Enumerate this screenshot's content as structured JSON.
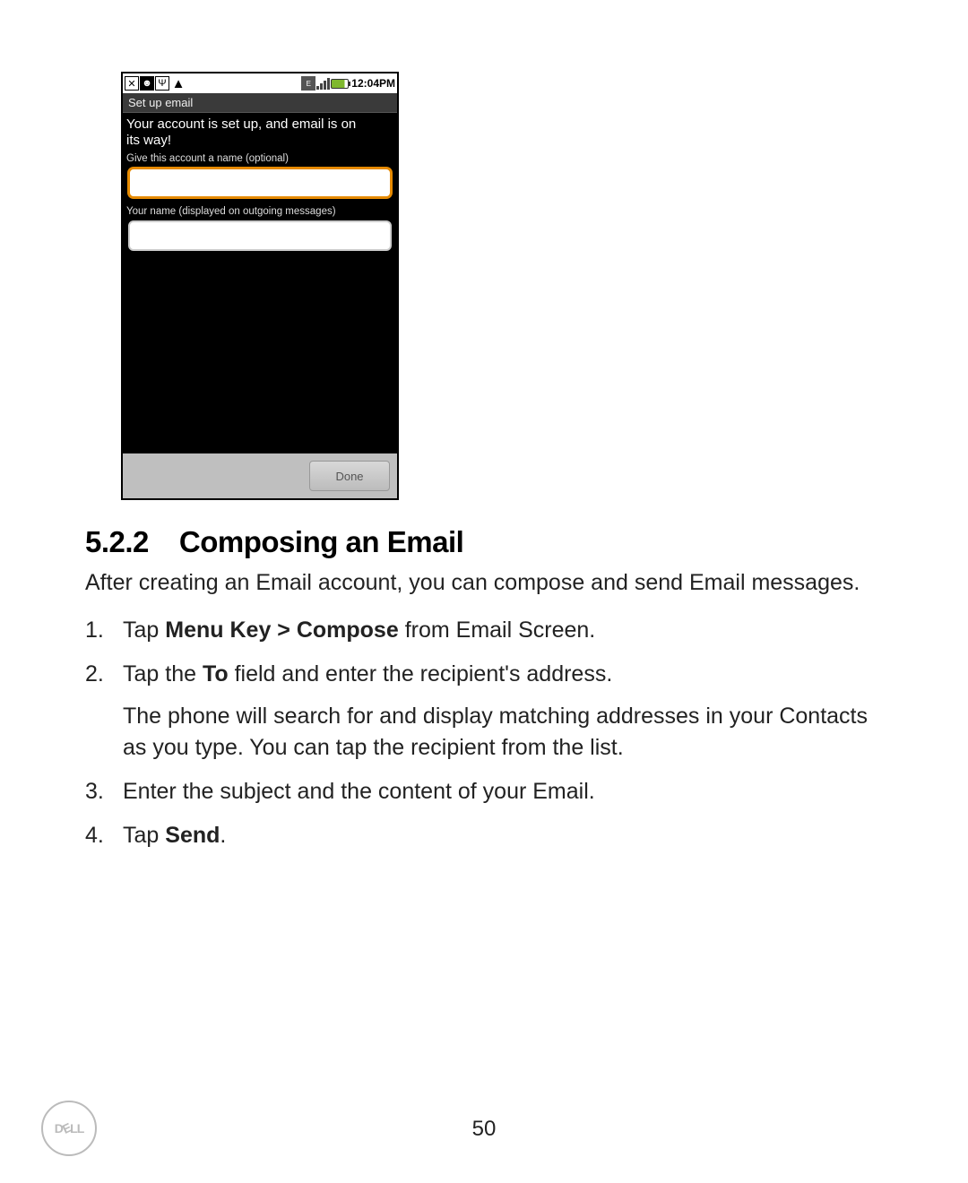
{
  "phone": {
    "time": "12:04PM",
    "title_bar": "Set up email",
    "setup_msg_line1": "Your account is set up, and email is on",
    "setup_msg_line2": " its way!",
    "label_account_name": "Give this account a name (optional)",
    "label_your_name": "Your name (displayed on outgoing messages)",
    "done": "Done"
  },
  "section": {
    "number": "5.2.2",
    "title": "Composing an Email",
    "intro": "After creating an Email account, you can compose and send Email messages.",
    "steps": [
      {
        "n": "1.",
        "pre": "Tap ",
        "bold": "Menu Key > Compose",
        "post": " from Email Screen."
      },
      {
        "n": "2.",
        "pre": "Tap the ",
        "bold": "To",
        "post": " field and enter the recipient's address.",
        "sub": "The phone will search for and display matching addresses in your Contacts as you type. You can tap the recipient from the list."
      },
      {
        "n": "3.",
        "pre": "Enter the subject and the content of your Email.",
        "bold": "",
        "post": ""
      },
      {
        "n": "4.",
        "pre": "Tap ",
        "bold": "Send",
        "post": "."
      }
    ]
  },
  "page_number": "50",
  "logo_text": "DELL"
}
